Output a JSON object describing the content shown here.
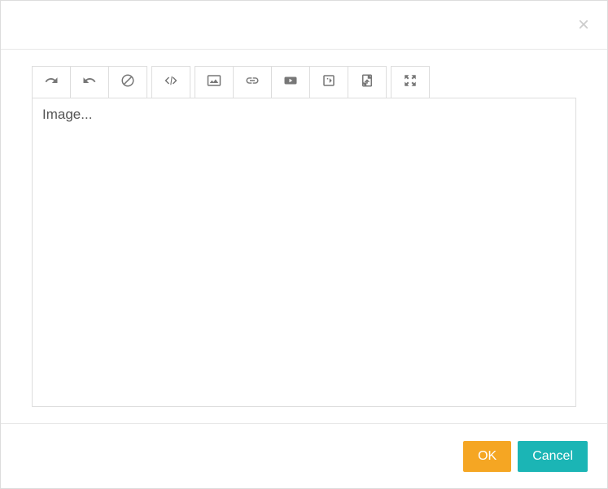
{
  "toolbar": {
    "redo": "redo",
    "undo": "undo",
    "clear": "clear",
    "code": "code",
    "image": "image",
    "link": "link",
    "video": "video",
    "embed_video": "embed-video",
    "file": "file",
    "fullscreen": "fullscreen"
  },
  "editor": {
    "placeholder": "Image..."
  },
  "footer": {
    "ok_label": "OK",
    "cancel_label": "Cancel"
  }
}
